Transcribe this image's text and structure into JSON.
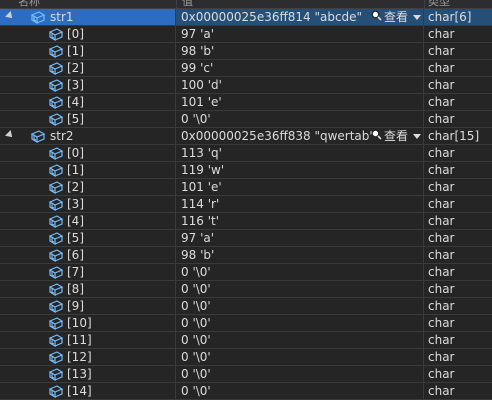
{
  "header": {
    "col_name": "名称",
    "col_value": "值",
    "col_type": "类型"
  },
  "variables": [
    {
      "name": "str1",
      "value": "0x00000025e36ff814 \"abcde\"",
      "view_label": "查看",
      "type": "char[6]",
      "expanded": true,
      "selected": true,
      "children": [
        {
          "name": "[0]",
          "value": "97 'a'",
          "type": "char"
        },
        {
          "name": "[1]",
          "value": "98 'b'",
          "type": "char"
        },
        {
          "name": "[2]",
          "value": "99 'c'",
          "type": "char"
        },
        {
          "name": "[3]",
          "value": "100 'd'",
          "type": "char"
        },
        {
          "name": "[4]",
          "value": "101 'e'",
          "type": "char"
        },
        {
          "name": "[5]",
          "value": "0 '\\0'",
          "type": "char"
        }
      ]
    },
    {
      "name": "str2",
      "value": "0x00000025e36ff838 \"qwertab\"",
      "view_label": "查看",
      "type": "char[15]",
      "expanded": true,
      "selected": false,
      "children": [
        {
          "name": "[0]",
          "value": "113 'q'",
          "type": "char"
        },
        {
          "name": "[1]",
          "value": "119 'w'",
          "type": "char"
        },
        {
          "name": "[2]",
          "value": "101 'e'",
          "type": "char"
        },
        {
          "name": "[3]",
          "value": "114 'r'",
          "type": "char"
        },
        {
          "name": "[4]",
          "value": "116 't'",
          "type": "char"
        },
        {
          "name": "[5]",
          "value": "97 'a'",
          "type": "char"
        },
        {
          "name": "[6]",
          "value": "98 'b'",
          "type": "char"
        },
        {
          "name": "[7]",
          "value": "0 '\\0'",
          "type": "char"
        },
        {
          "name": "[8]",
          "value": "0 '\\0'",
          "type": "char"
        },
        {
          "name": "[9]",
          "value": "0 '\\0'",
          "type": "char"
        },
        {
          "name": "[10]",
          "value": "0 '\\0'",
          "type": "char"
        },
        {
          "name": "[11]",
          "value": "0 '\\0'",
          "type": "char"
        },
        {
          "name": "[12]",
          "value": "0 '\\0'",
          "type": "char"
        },
        {
          "name": "[13]",
          "value": "0 '\\0'",
          "type": "char"
        },
        {
          "name": "[14]",
          "value": "0 '\\0'",
          "type": "char"
        }
      ]
    }
  ],
  "icons": {
    "variable": "watch-variable-icon",
    "view": "magnifier-icon"
  },
  "colors": {
    "background": "#252526",
    "selected_row": "#264f78",
    "selected_name_cell": "#2d6cc0",
    "text": "#dcdcdc",
    "icon_accent": "#75beff"
  }
}
